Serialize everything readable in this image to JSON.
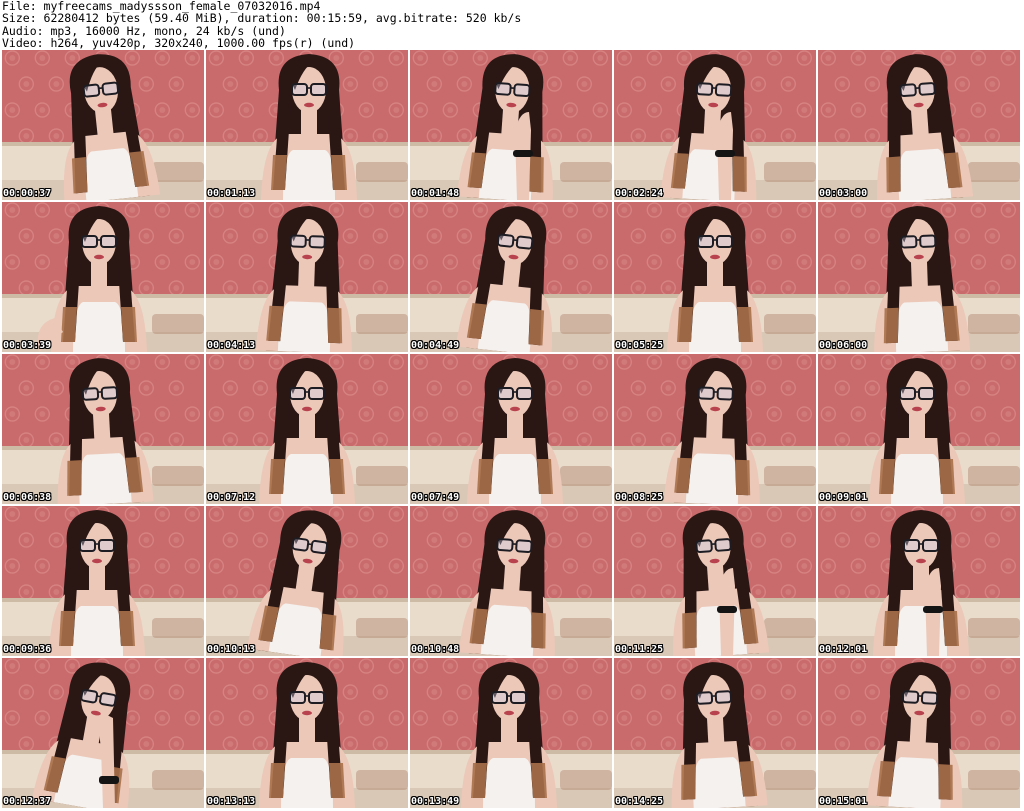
{
  "header": {
    "file_line": "File: myfreecams_madyssson_female_07032016.mp4",
    "size_line": "Size: 62280412 bytes (59.40 MiB), duration: 00:15:59, avg.bitrate: 520 kb/s",
    "audio_line": "Audio: mp3, 16000 Hz, mono, 24 kb/s (und)",
    "video_line": "Video: h264, yuv420p, 320x240, 1000.00 fps(r) (und)"
  },
  "thumbnails": [
    {
      "timestamp": "00:00:37"
    },
    {
      "timestamp": "00:01:13"
    },
    {
      "timestamp": "00:01:48"
    },
    {
      "timestamp": "00:02:24"
    },
    {
      "timestamp": "00:03:00"
    },
    {
      "timestamp": "00:03:39"
    },
    {
      "timestamp": "00:04:13"
    },
    {
      "timestamp": "00:04:49"
    },
    {
      "timestamp": "00:05:25"
    },
    {
      "timestamp": "00:06:00"
    },
    {
      "timestamp": "00:06:38"
    },
    {
      "timestamp": "00:07:12"
    },
    {
      "timestamp": "00:07:49"
    },
    {
      "timestamp": "00:08:25"
    },
    {
      "timestamp": "00:09:01"
    },
    {
      "timestamp": "00:09:36"
    },
    {
      "timestamp": "00:10:13"
    },
    {
      "timestamp": "00:10:48"
    },
    {
      "timestamp": "00:11:25"
    },
    {
      "timestamp": "00:12:01"
    },
    {
      "timestamp": "00:12:37"
    },
    {
      "timestamp": "00:13:13"
    },
    {
      "timestamp": "00:13:49"
    },
    {
      "timestamp": "00:14:25"
    },
    {
      "timestamp": "00:15:01"
    }
  ],
  "colors": {
    "wall": "#c96a6c",
    "wall_pattern": "#d98a88",
    "sofa": "#e9dccb",
    "sofa_shadow": "#cdbba6",
    "hair": "#2a1714",
    "hair_tips": "#a8704a",
    "skin": "#ecc8b9",
    "top": "#f4f1ee",
    "glasses": "#1c1c22",
    "lips": "#b8424e"
  }
}
